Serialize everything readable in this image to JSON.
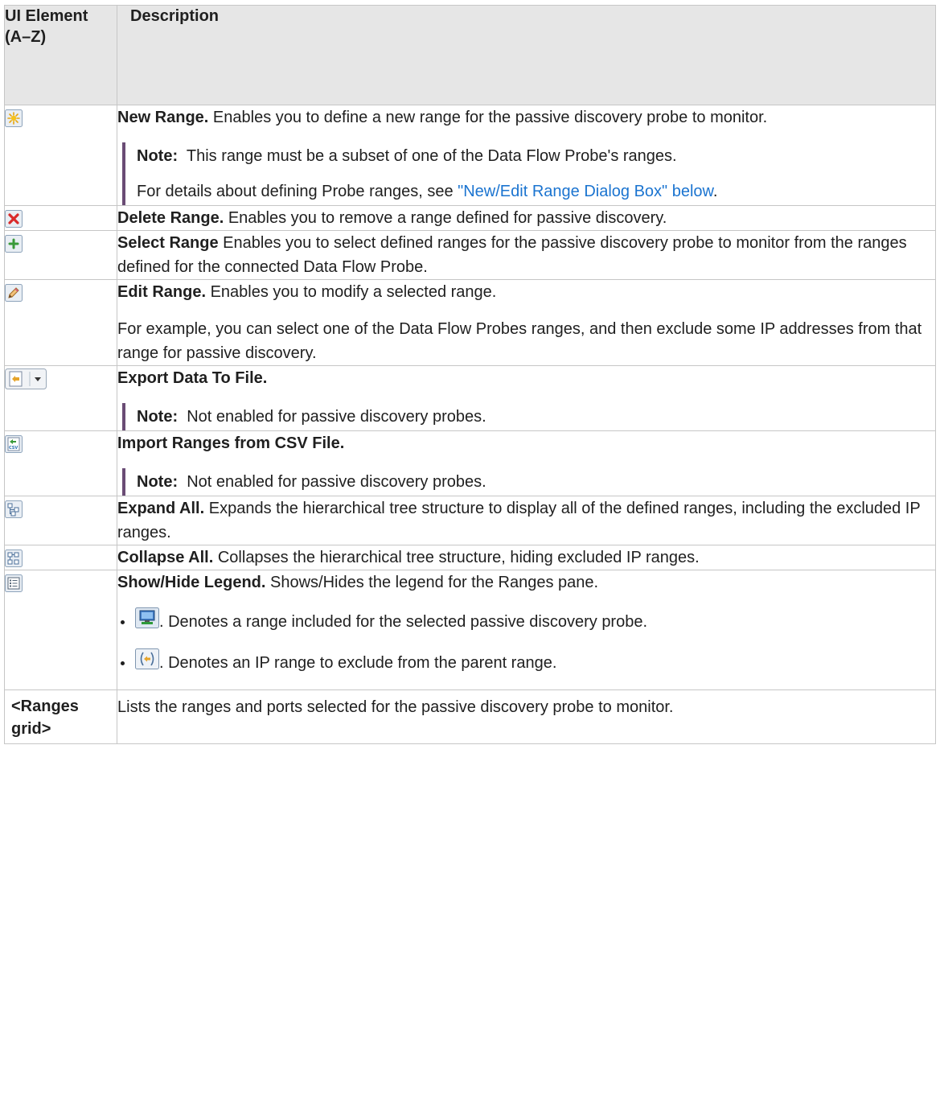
{
  "header": {
    "col_element": "UI Element (A–Z)",
    "col_description": "Description"
  },
  "rows": [
    {
      "icon": "new-range-icon",
      "title": "New Range.",
      "text": "Enables you to define a new range for the passive discovery probe to monitor.",
      "note_label": "Note:",
      "note_text": "This range must be a subset of one of the Data Flow Probe's ranges.",
      "note_para_prefix": "For details about defining Probe ranges, see ",
      "note_link": "\"New/Edit Range Dialog Box\" below",
      "note_para_suffix": "."
    },
    {
      "icon": "delete-range-icon",
      "title": "Delete Range.",
      "text": "Enables you to remove a range defined for passive discovery."
    },
    {
      "icon": "select-range-icon",
      "title": "Select Range",
      "text": "Enables you to select defined ranges for the passive discovery probe to monitor from the ranges defined for the connected Data Flow Probe."
    },
    {
      "icon": "edit-range-icon",
      "title": "Edit Range.",
      "text": "Enables you to modify a selected range.",
      "para2": "For example, you can select one of the Data Flow Probes ranges, and then exclude some IP addresses from that range for passive discovery."
    },
    {
      "icon": "export-data-icon",
      "title": "Export Data To File.",
      "note_label": "Note:",
      "note_text": "Not enabled for passive discovery probes."
    },
    {
      "icon": "import-csv-icon",
      "title": "Import Ranges from CSV File.",
      "note_label": "Note:",
      "note_text": "Not enabled for passive discovery probes."
    },
    {
      "icon": "expand-all-icon",
      "title": "Expand All.",
      "text": "Expands the hierarchical tree structure to display all of the defined ranges, including the excluded IP ranges."
    },
    {
      "icon": "collapse-all-icon",
      "title": "Collapse All.",
      "text": "Collapses the hierarchical tree structure, hiding excluded IP ranges."
    },
    {
      "icon": "show-hide-legend-icon",
      "title": "Show/Hide Legend.",
      "text": "Shows/Hides the legend for the Ranges pane.",
      "legend": [
        {
          "icon": "included-range-icon",
          "text": ". Denotes a range included for the selected passive discovery probe."
        },
        {
          "icon": "excluded-range-icon",
          "text": ". Denotes an IP range to exclude from the parent range."
        }
      ]
    },
    {
      "element_text": "<Ranges grid>",
      "text": "Lists the ranges and ports selected for the passive discovery probe to monitor."
    }
  ]
}
